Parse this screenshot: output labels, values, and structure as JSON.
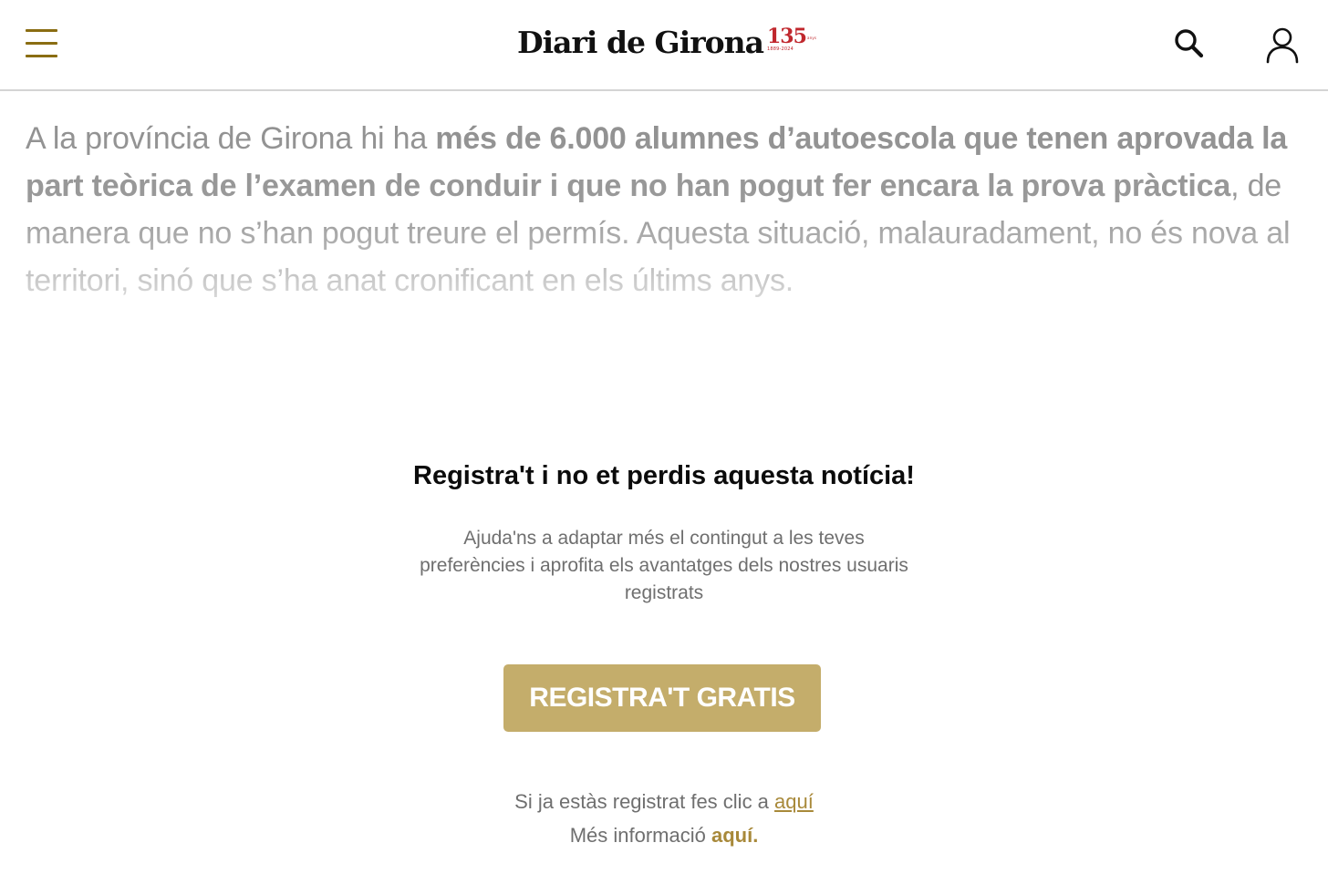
{
  "header": {
    "menu_icon": "hamburger-menu-icon",
    "logo_text": "Diari de Girona",
    "logo_badge_number": "135",
    "logo_badge_label": "anys",
    "logo_badge_years": "1889-2024",
    "search_icon": "search-icon",
    "user_icon": "user-account-icon",
    "accent_color": "#8a6d12",
    "brand_red": "#c0272d"
  },
  "article": {
    "part1": "A la província de Girona hi ha ",
    "bold1": "més de 6.000 alumnes d’autoescola que tenen aprovada la part teòrica de l’examen de conduir i que no han pogut fer encara la prova pràctica",
    "part2": ", de manera que no s’han pogut treure el permís. Aquesta situació, malauradament, no és nova al territori, sinó que s’ha anat cronificant en els últims anys."
  },
  "registration": {
    "title": "Registra't i no et perdis aquesta notícia!",
    "description": "Ajuda'ns a adaptar més el contingut a les teves preferències i aprofita els avantatges dels nostres usuaris registrats",
    "button_label": "REGISTRA'T GRATIS",
    "button_color": "#c4ad6b",
    "login_prompt": "Si ja estàs registrat fes clic a ",
    "login_link": "aquí",
    "info_prompt": "Més informació ",
    "info_link": "aquí."
  }
}
